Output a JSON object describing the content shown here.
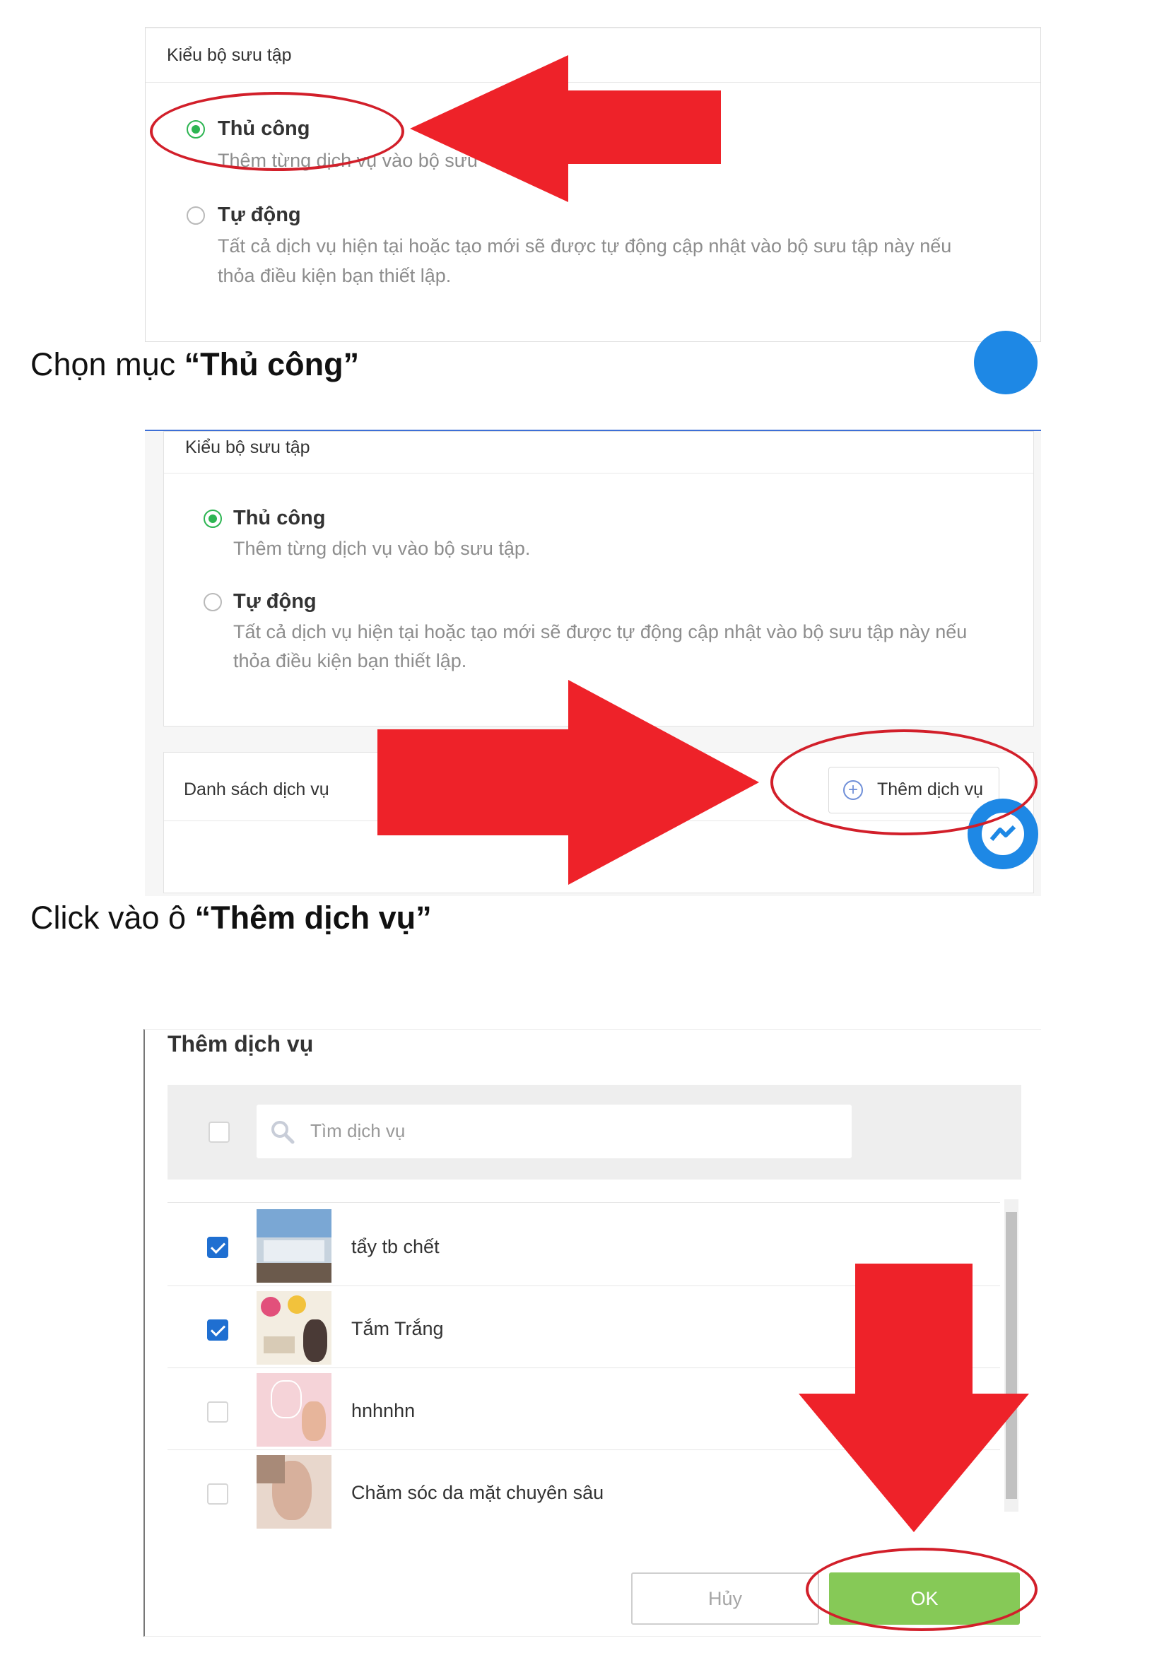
{
  "step1": {
    "card_title": "Kiểu bộ sưu tập",
    "manual_label": "Thủ công",
    "manual_desc": "Thêm từng dịch vụ vào bộ sưu",
    "auto_label": "Tự động",
    "auto_desc_line1": "Tất cả dịch vụ hiện tại hoặc tạo mới sẽ được tự động cập nhật vào bộ sưu tập này nếu",
    "auto_desc_line2": "thỏa điều kiện bạn thiết lập.",
    "caption_prefix": "Chọn mục ",
    "caption_bold": "“Thủ công”"
  },
  "step2": {
    "card_title": "Kiểu bộ sưu tập",
    "manual_label": "Thủ công",
    "manual_desc": "Thêm từng dịch vụ vào bộ sưu tập.",
    "auto_label": "Tự động",
    "auto_desc_line1": "Tất cả dịch vụ hiện tại hoặc tạo mới sẽ được tự động cập nhật vào bộ sưu tập này nếu",
    "auto_desc_line2": "thỏa điều kiện bạn thiết lập.",
    "service_list_title": "Danh sách dịch vụ",
    "add_service_label": "Thêm dịch vụ",
    "caption_prefix": "Click vào ô ",
    "caption_bold": "“Thêm dịch vụ”"
  },
  "step3": {
    "dialog_title": "Thêm dịch vụ",
    "search_placeholder": "Tìm dịch vụ",
    "items": [
      {
        "name": "tẩy tb chết",
        "checked": true
      },
      {
        "name": "Tắm Trắng",
        "checked": true
      },
      {
        "name": "hnhnhn",
        "checked": false
      },
      {
        "name": "Chăm sóc da mặt chuyên sâu",
        "checked": false
      }
    ],
    "cancel_label": "Hủy",
    "ok_label": "OK"
  },
  "colors": {
    "accent_green": "#2db552",
    "ok_green": "#86c957",
    "arrow_red": "#ee2229",
    "check_blue": "#1f6fd1",
    "messenger_blue": "#1e88e5"
  },
  "icons": [
    "radio-icon",
    "arrow-icon",
    "plus-circle-icon",
    "messenger-icon",
    "search-icon",
    "checkbox-icon"
  ]
}
